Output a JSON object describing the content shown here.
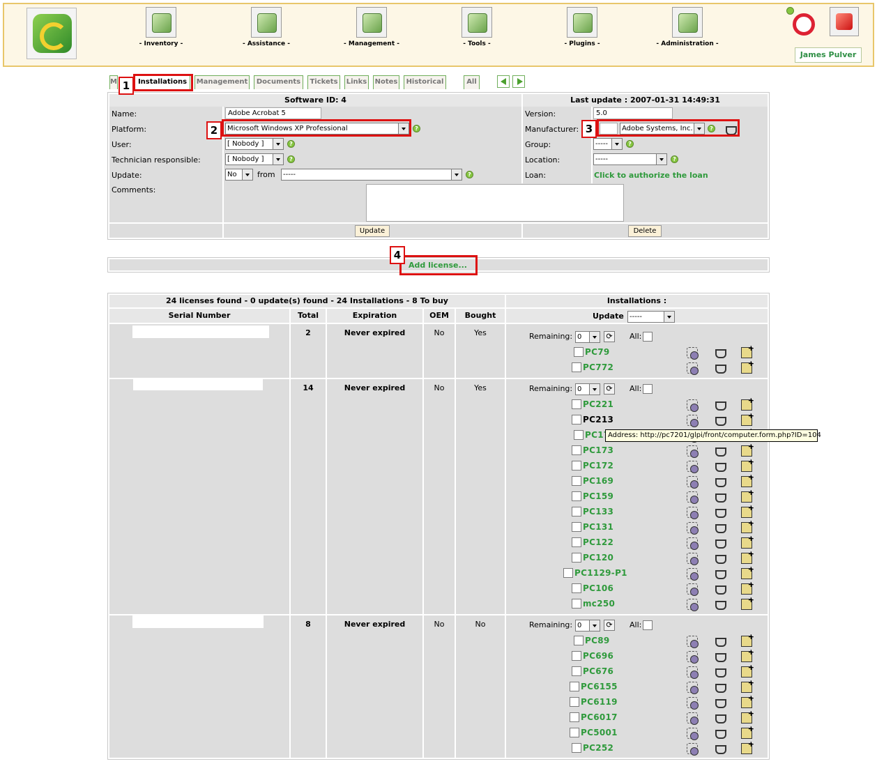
{
  "nav": [
    {
      "label": "- Inventory -",
      "icon": "inventory-icon"
    },
    {
      "label": "- Assistance -",
      "icon": "assistance-icon"
    },
    {
      "label": "- Management -",
      "icon": "management-icon"
    },
    {
      "label": "- Tools -",
      "icon": "tools-icon"
    },
    {
      "label": "- Plugins -",
      "icon": "plugins-icon"
    },
    {
      "label": "- Administration -",
      "icon": "administration-icon"
    }
  ],
  "user_name": "James Pulver",
  "tabs": [
    "M",
    "Installations",
    "Management",
    "Documents",
    "Tickets",
    "Links",
    "Notes",
    "Historical",
    "All"
  ],
  "callouts": [
    "1",
    "2",
    "3",
    "4"
  ],
  "form": {
    "software_id": "Software ID: 4",
    "last_update": "Last update : 2007-01-31 14:49:31",
    "name_label": "Name:",
    "name_value": "Adobe Acrobat 5",
    "platform_label": "Platform:",
    "platform_value": "Microsoft Windows XP Professional",
    "user_label": "User:",
    "user_value": "[ Nobody ]",
    "tech_label": "Technician responsible:",
    "tech_value": "[ Nobody ]",
    "update_label": "Update:",
    "update_value": "No",
    "from_label": "from",
    "from_value": "-----",
    "comments_label": "Comments:",
    "version_label": "Version:",
    "version_value": "5.0",
    "manufacturer_label": "Manufacturer:",
    "manufacturer_value": "Adobe Systems, Inc.",
    "group_label": "Group:",
    "group_value": "-----",
    "location_label": "Location:",
    "location_value": "-----",
    "loan_label": "Loan:",
    "loan_link": "Click to authorize the loan",
    "update_button": "Update",
    "delete_button": "Delete",
    "help_glyph": "?"
  },
  "add_license": "Add license...",
  "licenses": {
    "summary": "24 licenses found - 0 update(s) found - 24 Installations - 8 To buy",
    "installations_header": "Installations :",
    "col_serial": "Serial Number",
    "col_total": "Total",
    "col_expiration": "Expiration",
    "col_oem": "OEM",
    "col_bought": "Bought",
    "update_label": "Update",
    "update_select": "-----",
    "remaining_label": "Remaining:",
    "remaining_value": "0",
    "all_label": "All:",
    "refresh_glyph": "⟳",
    "groups": [
      {
        "total": "2",
        "expiration": "Never expired",
        "oem": "No",
        "bought": "Yes",
        "pcs": [
          "PC79",
          "PC772"
        ]
      },
      {
        "total": "14",
        "expiration": "Never expired",
        "oem": "No",
        "bought": "Yes",
        "pcs": [
          "PC221",
          "PC213",
          "PC17",
          "PC173",
          "PC172",
          "PC169",
          "PC159",
          "PC133",
          "PC131",
          "PC122",
          "PC120",
          "PC1129-P1",
          "PC106",
          "mc250"
        ]
      },
      {
        "total": "8",
        "expiration": "Never expired",
        "oem": "No",
        "bought": "No",
        "pcs": [
          "PC89",
          "PC696",
          "PC676",
          "PC6155",
          "PC6119",
          "PC6017",
          "PC5001",
          "PC252"
        ]
      }
    ]
  },
  "tooltip": "Address: http://pc7201/glpi/front/computer.form.php?ID=104"
}
